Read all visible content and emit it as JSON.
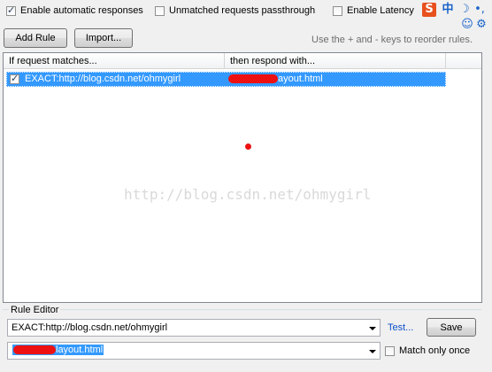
{
  "options": {
    "auto_responses": {
      "label": "Enable automatic responses",
      "checked": true
    },
    "unmatched_passthrough": {
      "label": "Unmatched requests passthrough",
      "checked": false
    },
    "latency": {
      "label": "Enable Latency",
      "checked": false
    }
  },
  "toolbar": {
    "add_rule_label": "Add Rule",
    "import_label": "Import...",
    "reorder_hint": "Use the + and - keys to reorder rules."
  },
  "rules_table": {
    "columns": [
      "If request matches...",
      "then respond with..."
    ],
    "rows": [
      {
        "checked": true,
        "match": "EXACT:http://blog.csdn.net/ohmygirl",
        "respond": "ayout.html",
        "selected": true
      }
    ]
  },
  "watermark": "http://blog.csdn.net/ohmygirl",
  "rule_editor": {
    "title": "Rule Editor",
    "match_value": "EXACT:http://blog.csdn.net/ohmygirl",
    "respond_value": "layout.html",
    "test_label": "Test...",
    "save_label": "Save",
    "match_once": {
      "label": "Match only once",
      "checked": false
    }
  },
  "tray": {
    "ime_label": "中",
    "colors": {
      "sogou": "#e8501e",
      "ime": "#1a64c8"
    }
  },
  "colors": {
    "selection": "#3399ff",
    "redaction": "#ee1111",
    "link": "#0b50c9"
  }
}
